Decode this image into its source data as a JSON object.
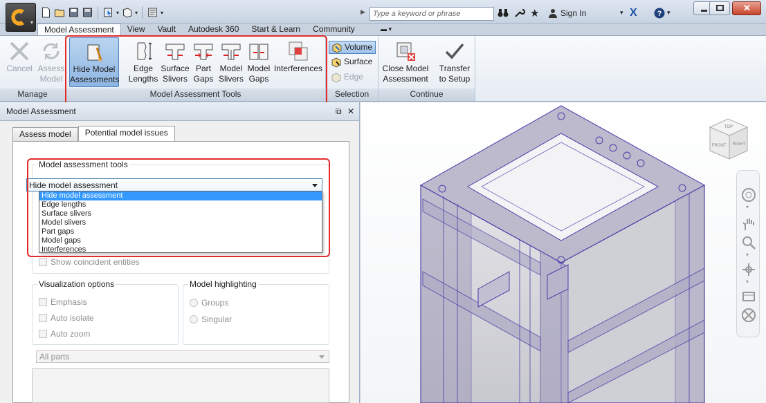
{
  "quick_access": {
    "icons": [
      "new-icon",
      "open-icon",
      "save-icon",
      "save-all-icon",
      "select-icon",
      "appearance-icon",
      "properties-icon"
    ]
  },
  "search": {
    "placeholder": "Type a keyword or phrase"
  },
  "header": {
    "sign_in": "Sign In"
  },
  "ribbon_tabs": [
    {
      "label": "Model Assessment",
      "active": true
    },
    {
      "label": "View"
    },
    {
      "label": "Vault"
    },
    {
      "label": "Autodesk 360"
    },
    {
      "label": "Start & Learn"
    },
    {
      "label": "Community"
    }
  ],
  "ribbon": {
    "manage": {
      "title": "Manage",
      "cancel": "Cancel",
      "assess_line1": "Assess",
      "assess_line2": "Model"
    },
    "tools": {
      "title": "Model Assessment Tools",
      "hide_line1": "Hide Model",
      "hide_line2": "Assessments",
      "edge_line1": "Edge",
      "edge_line2": "Lengths",
      "surface_line1": "Surface",
      "surface_line2": "Slivers",
      "partgaps_line1": "Part",
      "partgaps_line2": "Gaps",
      "modelslivers_line1": "Model",
      "modelslivers_line2": "Slivers",
      "modelgaps_line1": "Model",
      "modelgaps_line2": "Gaps",
      "interferences": "Interferences"
    },
    "selection": {
      "title": "Selection",
      "volume": "Volume",
      "surface": "Surface",
      "edge": "Edge"
    },
    "continue": {
      "title": "Continue",
      "close_line1": "Close Model",
      "close_line2": "Assessment",
      "transfer_line1": "Transfer",
      "transfer_line2": "to Setup"
    }
  },
  "side_panel": {
    "title": "Model Assessment",
    "tabs": [
      {
        "label": "Assess model"
      },
      {
        "label": "Potential model issues",
        "active": true
      }
    ],
    "tools_group_label": "Model assessment tools",
    "tools_selected": "Hide model assessment",
    "tools_options": [
      "Hide model assessment",
      "Edge lengths",
      "Surface slivers",
      "Model slivers",
      "Part gaps",
      "Model gaps",
      "Interferences"
    ],
    "show_coincident": "Show coincident entities",
    "visualization_label": "Visualization options",
    "emphasis": "Emphasis",
    "auto_isolate": "Auto isolate",
    "auto_zoom": "Auto zoom",
    "highlighting_label": "Model highlighting",
    "groups": "Groups",
    "singular": "Singular",
    "parts_filter": "All parts"
  },
  "viewcube": {
    "top": "TOP",
    "front": "FRONT",
    "right": "RIGHT"
  },
  "colors": {
    "highlight_frame": "#e32b2b",
    "selection_blue": "#3399ff",
    "model_edges": "#4a3fa8"
  }
}
